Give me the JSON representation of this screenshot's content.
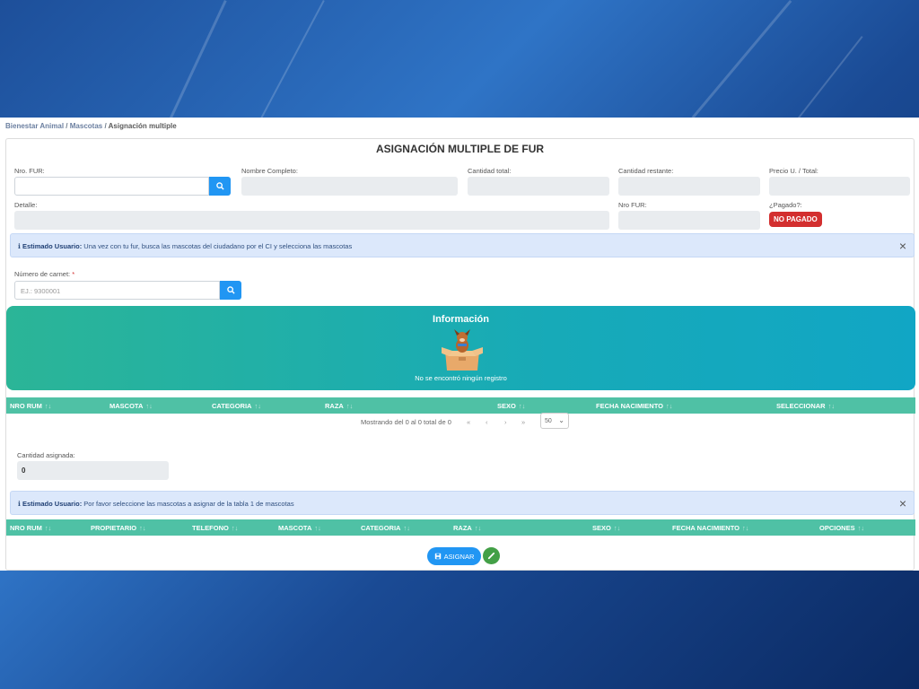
{
  "breadcrumb": {
    "item1": "Bienestar Animal",
    "sep": "/",
    "item2": "Mascotas",
    "current": "Asignación multiple"
  },
  "title": "ASIGNACIÓN MULTIPLE DE FUR",
  "form": {
    "nro_fur_label": "Nro. FUR:",
    "nombre_label": "Nombre Completo:",
    "cantidad_total_label": "Cantidad total:",
    "cantidad_restante_label": "Cantidad restante:",
    "precio_label": "Precio U. / Total:",
    "detalle_label": "Detalle:",
    "nro_fur2_label": "Nro FUR:",
    "pagado_label": "¿Pagado?:",
    "pagado_badge": "NO PAGADO"
  },
  "alert1": {
    "bold": "Estimado Usuario:",
    "text": " Una vez con tu fur, busca las mascotas del ciudadano por el CI y selecciona las mascotas"
  },
  "carnet": {
    "label": "Número de carnet:",
    "required": "*",
    "placeholder": "EJ.: 9300001"
  },
  "info": {
    "title": "Información",
    "message": "No se encontró ningún registro"
  },
  "table1": {
    "columns": [
      "NRO RUM",
      "MASCOTA",
      "CATEGORIA",
      "RAZA",
      "SEXO",
      "FECHA NACIMIENTO",
      "SELECCIONAR"
    ]
  },
  "pager": {
    "text": "Mostrando del 0 al 0 total de 0",
    "first": "«",
    "prev": "‹",
    "next": "›",
    "last": "»",
    "page_size": "50"
  },
  "cantidad_asignada": {
    "label": "Cantidad asignada:",
    "value": "0"
  },
  "alert2": {
    "bold": "Estimado Usuario:",
    "text": " Por favor seleccione las mascotas a asignar de la tabla 1 de mascotas"
  },
  "table2": {
    "columns": [
      "NRO RUM",
      "PROPIETARIO",
      "TELEFONO",
      "MASCOTA",
      "CATEGORIA",
      "RAZA",
      "SEXO",
      "FECHA NACIMIENTO",
      "OPCIONES"
    ]
  },
  "actions": {
    "asignar": "ASIGNAR"
  },
  "colors": {
    "primary": "#2196f3",
    "teal": "#4fc1a5",
    "danger": "#d32f2f",
    "success": "#43a047"
  }
}
